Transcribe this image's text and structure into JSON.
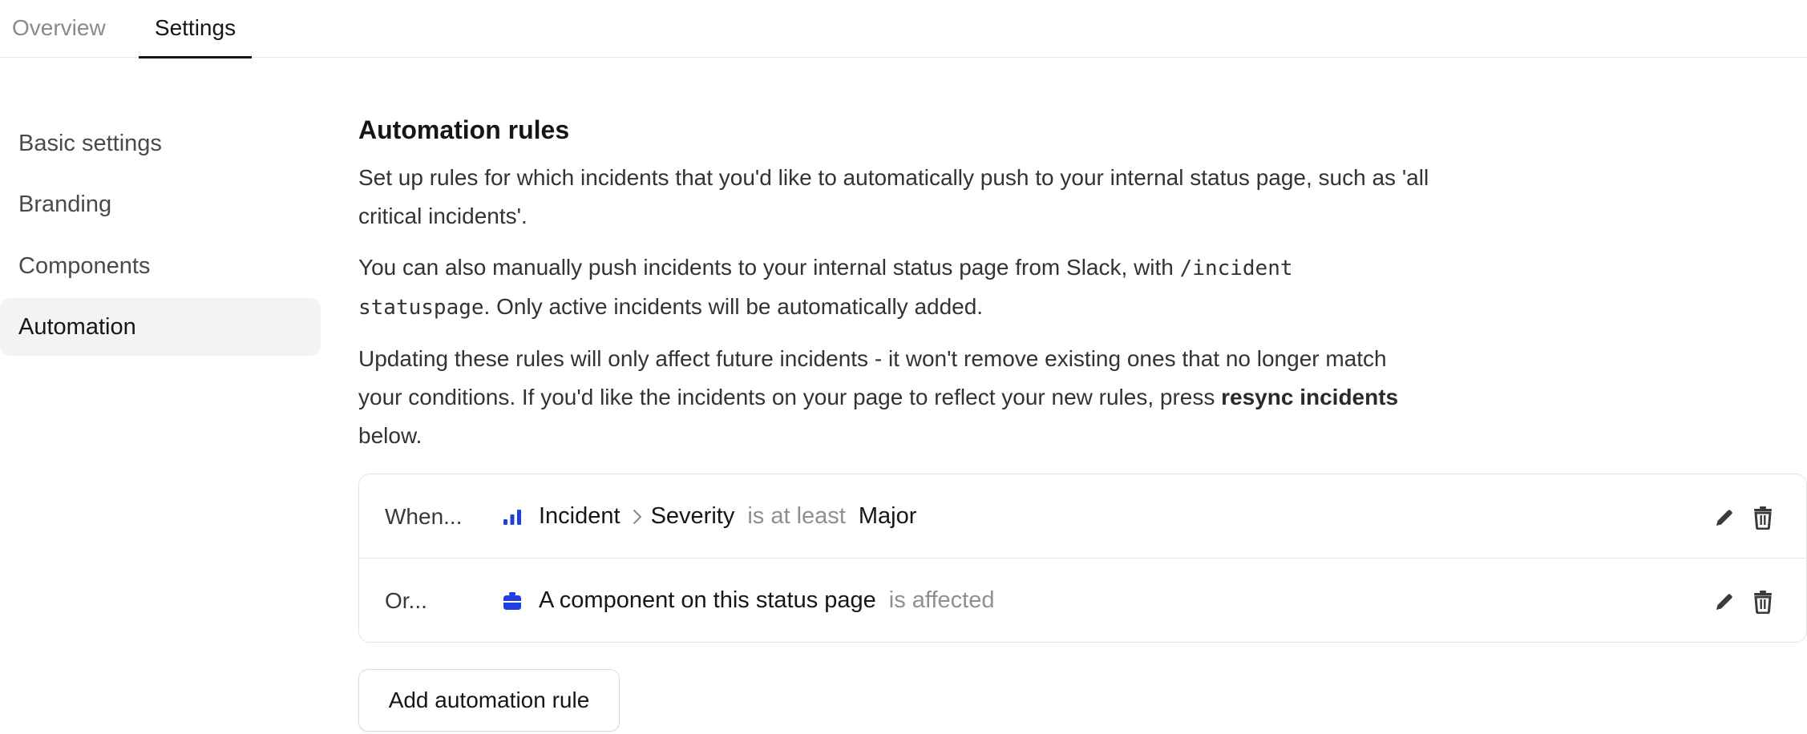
{
  "tabs": [
    {
      "label": "Overview",
      "active": false
    },
    {
      "label": "Settings",
      "active": true
    }
  ],
  "sidebar": {
    "items": [
      {
        "label": "Basic settings",
        "active": false
      },
      {
        "label": "Branding",
        "active": false
      },
      {
        "label": "Components",
        "active": false
      },
      {
        "label": "Automation",
        "active": true
      }
    ]
  },
  "main": {
    "title": "Automation rules",
    "para1": "Set up rules for which incidents that you'd like to automatically push to your internal status page, such as 'all critical incidents'.",
    "para2_prefix": "You can also manually push incidents to your internal status page from Slack, with ",
    "para2_code": "/incident statuspage",
    "para2_suffix": ". Only active incidents will be automatically added.",
    "para3_prefix": "Updating these rules will only affect future incidents - it won't remove existing ones that no longer match your conditions. If you'd like the incidents on your page to reflect your new rules, press ",
    "para3_bold": "resync incidents",
    "para3_suffix": " below."
  },
  "rules": [
    {
      "prefix": "When...",
      "icon": "severity-bars-icon",
      "subject": "Incident",
      "field": "Severity",
      "operator": "is at least",
      "value": "Major"
    },
    {
      "prefix": "Or...",
      "icon": "component-box-icon",
      "subject": "A component on this status page",
      "operator": "is affected"
    }
  ],
  "add_rule_label": "Add automation rule",
  "colors": {
    "accent_blue": "#1f3fe0",
    "active_bg": "#f3f3f2",
    "muted_text": "#8f8f8f"
  }
}
